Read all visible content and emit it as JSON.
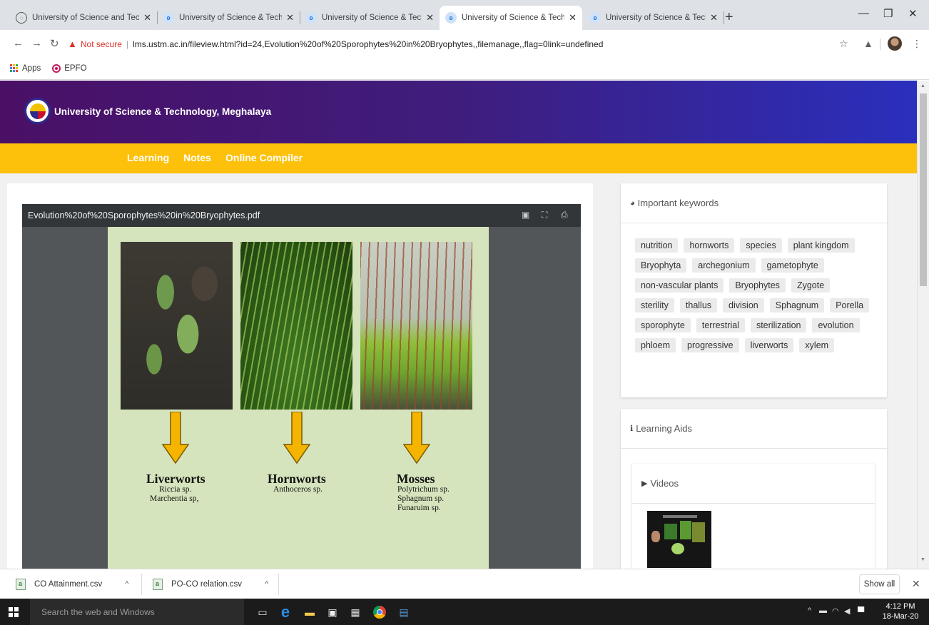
{
  "browser": {
    "tabs": [
      {
        "title": "University of Science and Techno",
        "favicon": "globe-icon"
      },
      {
        "title": "University of Science & Technolo",
        "favicon": "lms-icon"
      },
      {
        "title": "University of Science & Technolo",
        "favicon": "lms-icon"
      },
      {
        "title": "University of Science & Technolo",
        "favicon": "lms-icon",
        "active": true
      },
      {
        "title": "University of Science & Technolo",
        "favicon": "lms-icon"
      }
    ],
    "new_tab": "+",
    "address": {
      "warning_icon": "▲",
      "security_text": "Not secure",
      "url": "lms.ustm.ac.in/fileview.html?id=24,Evolution%20of%20Sporophytes%20in%20Bryophytes,,filemanage,,flag=0link=undefined"
    },
    "bookmarks": [
      {
        "label": "Apps",
        "icon": "apps-grid-icon"
      },
      {
        "label": "EPFO",
        "icon": "epfo-icon"
      }
    ]
  },
  "site": {
    "name": "University of Science & Technology, Meghalaya",
    "brand_purple": "#4a1066",
    "brand_yellow": "#fdc10c",
    "menu": [
      "Learning",
      "Notes",
      "Online Compiler"
    ]
  },
  "viewer": {
    "file_name": "Evolution%20of%20Sporophytes%20in%20Bryophytes.pdf",
    "slide": {
      "groups": [
        {
          "name": "Liverworts",
          "species": [
            "Riccia sp.",
            "Marchentia sp,"
          ]
        },
        {
          "name": "Hornworts",
          "species": [
            "Anthoceros sp."
          ]
        },
        {
          "name": "Mosses",
          "species": [
            "Polytrichum sp.",
            "Sphagnum  sp.",
            "Funaruim sp."
          ]
        }
      ]
    }
  },
  "sidebar": {
    "keywords_title": "Important keywords",
    "keywords": [
      "nutrition",
      "hornworts",
      "species",
      "plant kingdom",
      "Bryophyta",
      "archegonium",
      "gametophyte",
      "non-vascular plants",
      "Bryophytes",
      "Zygote",
      "sterility",
      "thallus",
      "division",
      "Sphagnum",
      "Porella",
      "sporophyte",
      "terrestrial",
      "sterilization",
      "evolution",
      "phloem",
      "progressive",
      "liverworts",
      "xylem"
    ],
    "learning_aids_title": "Learning Aids",
    "videos_title": "Videos"
  },
  "downloads": {
    "items": [
      "CO Attainment.csv",
      "PO-CO relation.csv"
    ],
    "show_all": "Show all"
  },
  "taskbar": {
    "search_placeholder": "Search the web and Windows",
    "time": "4:12 PM",
    "date": "18-Mar-20"
  }
}
